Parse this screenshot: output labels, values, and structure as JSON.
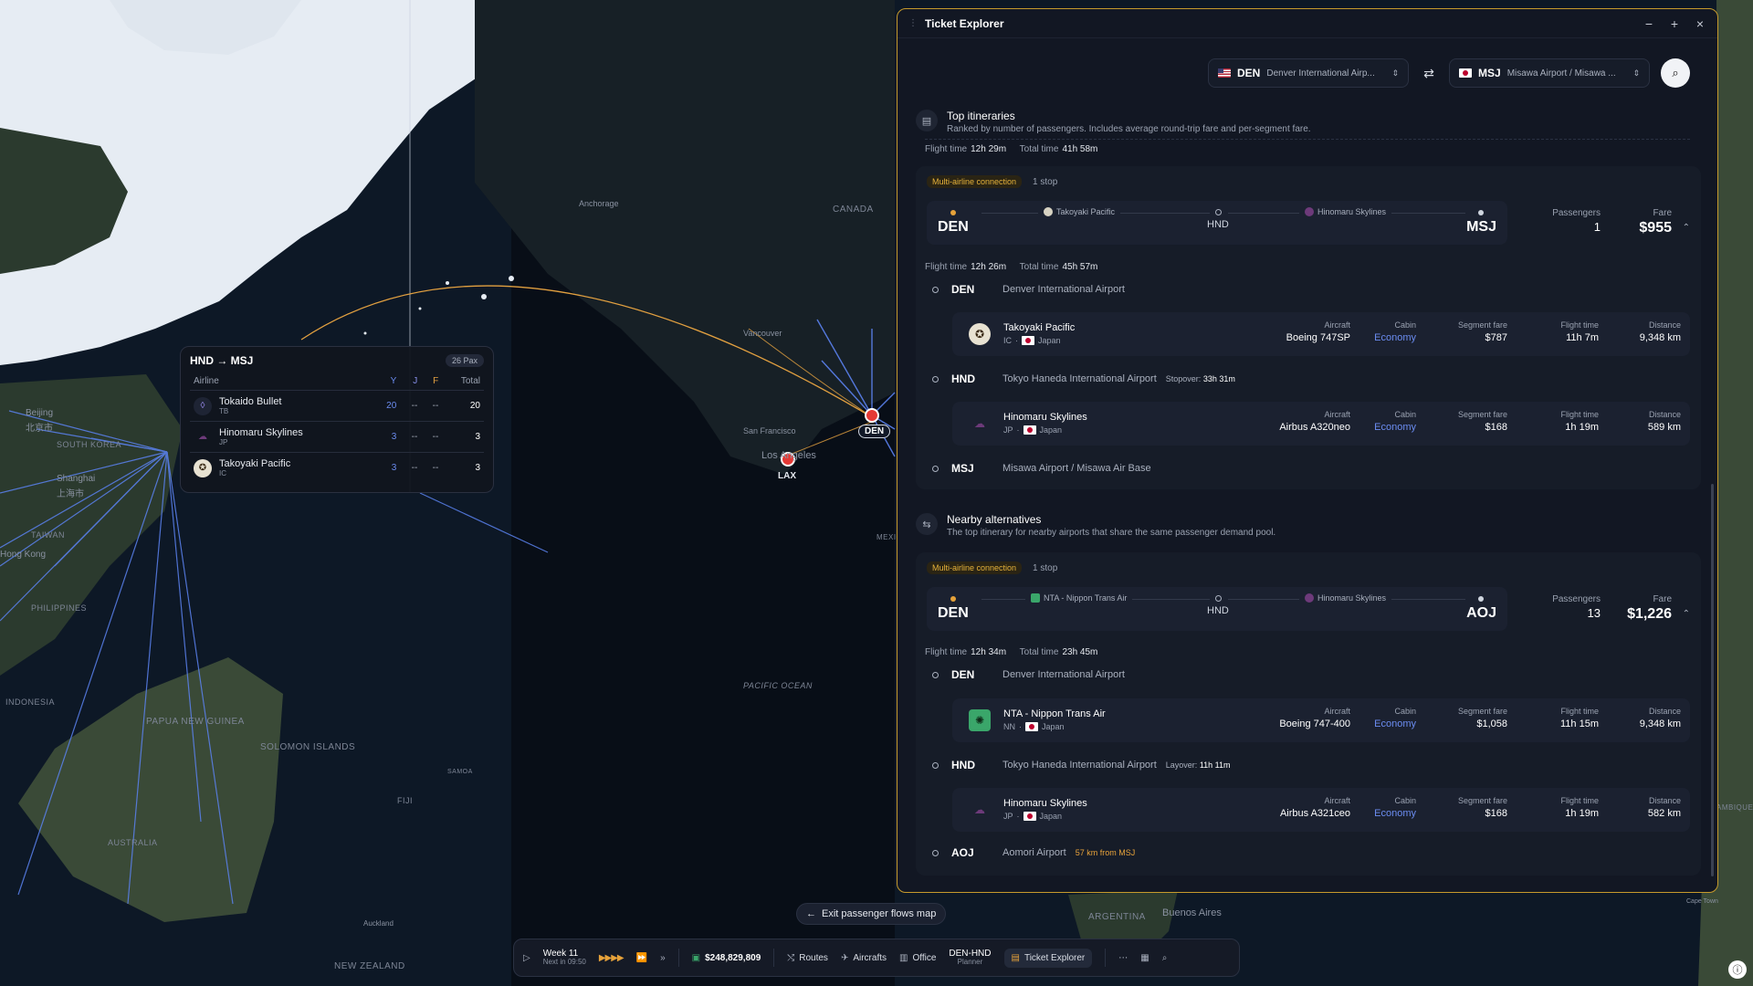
{
  "map": {
    "labels": {
      "canada": "CANADA",
      "anchorage": "Anchorage",
      "vancouver": "Vancouver",
      "san_francisco": "San Francisco",
      "los_angeles": "Los Angeles",
      "pacific": "PACIFIC OCEAN",
      "beijing": "Beijing",
      "beijing_cn": "北京市",
      "shanghai": "Shanghai",
      "shanghai_cn": "上海市",
      "south_korea": "SOUTH KOREA",
      "taiwan": "TAIWAN",
      "hong_kong": "Hong Kong",
      "philippines": "PHILIPPINES",
      "indonesia": "INDONESIA",
      "papua": "PAPUA NEW GUINEA",
      "solomon": "SOLOMON ISLANDS",
      "samoa": "SAMOA",
      "fiji": "FIJI",
      "australia": "AUSTRALIA",
      "auckland": "Auckland",
      "new_zealand": "NEW ZEALAND",
      "argentina": "ARGENTINA",
      "buenos_aires": "Buenos Aires",
      "mexico": "MEXICO",
      "cape_town": "Cape Town",
      "ambique": "AMBIQUE"
    },
    "airports": {
      "den": "DEN",
      "lax": "LAX"
    },
    "colors": {
      "land": "#2b3a2e",
      "ice": "#e6ecf3",
      "ocean": "#0d1826",
      "route_y": "#5b82f0",
      "route_arc": "#e2a040",
      "airport": "#e53935"
    }
  },
  "route_popup": {
    "title": "HND → MSJ",
    "pax": "26 Pax",
    "headers": {
      "airline": "Airline",
      "y": "Y",
      "j": "J",
      "f": "F",
      "total": "Total"
    },
    "rows": [
      {
        "name": "Tokaido Bullet",
        "code": "TB",
        "y": "20",
        "j": "--",
        "f": "--",
        "total": "20",
        "logo_icon": "bullet-train-icon"
      },
      {
        "name": "Hinomaru Skylines",
        "code": "JP",
        "y": "3",
        "j": "--",
        "f": "--",
        "total": "3",
        "logo_icon": "cloud-icon"
      },
      {
        "name": "Takoyaki Pacific",
        "code": "IC",
        "y": "3",
        "j": "--",
        "f": "--",
        "total": "3",
        "logo_icon": "octopus-icon"
      }
    ]
  },
  "window": {
    "title": "Ticket Explorer",
    "origin": {
      "code": "DEN",
      "name": "Denver International Airp..."
    },
    "dest": {
      "code": "MSJ",
      "name": "Misawa Airport / Misawa ..."
    },
    "top": {
      "title": "Top itineraries",
      "subtitle": "Ranked by number of passengers. Includes average round-trip fare and per-segment fare.",
      "flight_time_label": "Flight time",
      "flight_time": "12h 29m",
      "total_time_label": "Total time",
      "total_time": "41h 58m"
    },
    "card1": {
      "badge": "Multi-airline connection",
      "stops": "1 stop",
      "origin": "DEN",
      "hub": "HND",
      "dest": "MSJ",
      "seg1_airline": "Takoyaki Pacific",
      "seg2_airline": "Hinomaru Skylines",
      "passengers_label": "Passengers",
      "passengers": "1",
      "fare_label": "Fare",
      "fare": "$955",
      "flight_time_label": "Flight time",
      "flight_time": "12h 26m",
      "total_time_label": "Total time",
      "total_time": "45h 57m",
      "stop1": {
        "code": "DEN",
        "name": "Denver International Airport"
      },
      "seg1": {
        "airline": "Takoyaki Pacific",
        "code": "IC",
        "country": "Japan",
        "aircraft_label": "Aircraft",
        "aircraft": "Boeing 747SP",
        "cabin_label": "Cabin",
        "cabin": "Economy",
        "fare_label": "Segment fare",
        "fare": "$787",
        "time_label": "Flight time",
        "time": "11h 7m",
        "dist_label": "Distance",
        "dist": "9,348 km"
      },
      "stop2": {
        "code": "HND",
        "name": "Tokyo Haneda International Airport",
        "extra_label": "Stopover:",
        "extra": "33h 31m"
      },
      "seg2": {
        "airline": "Hinomaru Skylines",
        "code": "JP",
        "country": "Japan",
        "aircraft_label": "Aircraft",
        "aircraft": "Airbus A320neo",
        "cabin_label": "Cabin",
        "cabin": "Economy",
        "fare_label": "Segment fare",
        "fare": "$168",
        "time_label": "Flight time",
        "time": "1h 19m",
        "dist_label": "Distance",
        "dist": "589 km"
      },
      "stop3": {
        "code": "MSJ",
        "name": "Misawa Airport / Misawa Air Base"
      }
    },
    "nearby": {
      "title": "Nearby alternatives",
      "subtitle": "The top itinerary for nearby airports that share the same passenger demand pool."
    },
    "card2": {
      "badge": "Multi-airline connection",
      "stops": "1 stop",
      "origin": "DEN",
      "hub": "HND",
      "dest": "AOJ",
      "seg1_airline": "NTA - Nippon Trans Air",
      "seg2_airline": "Hinomaru Skylines",
      "passengers_label": "Passengers",
      "passengers": "13",
      "fare_label": "Fare",
      "fare": "$1,226",
      "flight_time_label": "Flight time",
      "flight_time": "12h 34m",
      "total_time_label": "Total time",
      "total_time": "23h 45m",
      "stop1": {
        "code": "DEN",
        "name": "Denver International Airport"
      },
      "seg1": {
        "airline": "NTA - Nippon Trans Air",
        "code": "NN",
        "country": "Japan",
        "aircraft_label": "Aircraft",
        "aircraft": "Boeing 747-400",
        "cabin_label": "Cabin",
        "cabin": "Economy",
        "fare_label": "Segment fare",
        "fare": "$1,058",
        "time_label": "Flight time",
        "time": "11h 15m",
        "dist_label": "Distance",
        "dist": "9,348 km"
      },
      "stop2": {
        "code": "HND",
        "name": "Tokyo Haneda International Airport",
        "extra_label": "Layover:",
        "extra": "11h 11m"
      },
      "seg2": {
        "airline": "Hinomaru Skylines",
        "code": "JP",
        "country": "Japan",
        "aircraft_label": "Aircraft",
        "aircraft": "Airbus A321ceo",
        "cabin_label": "Cabin",
        "cabin": "Economy",
        "fare_label": "Segment fare",
        "fare": "$168",
        "time_label": "Flight time",
        "time": "1h 19m",
        "dist_label": "Distance",
        "dist": "582 km"
      },
      "stop3": {
        "code": "AOJ",
        "name": "Aomori Airport",
        "near": "57 km from MSJ"
      }
    }
  },
  "bottom": {
    "exit": "Exit passenger flows map",
    "week": "Week 11",
    "next": "Next in 09:50",
    "money": "$248,829,809",
    "routes": "Routes",
    "aircrafts": "Aircrafts",
    "office": "Office",
    "planner_route": "DEN-HND",
    "planner": "Planner",
    "ticket_explorer": "Ticket Explorer"
  }
}
